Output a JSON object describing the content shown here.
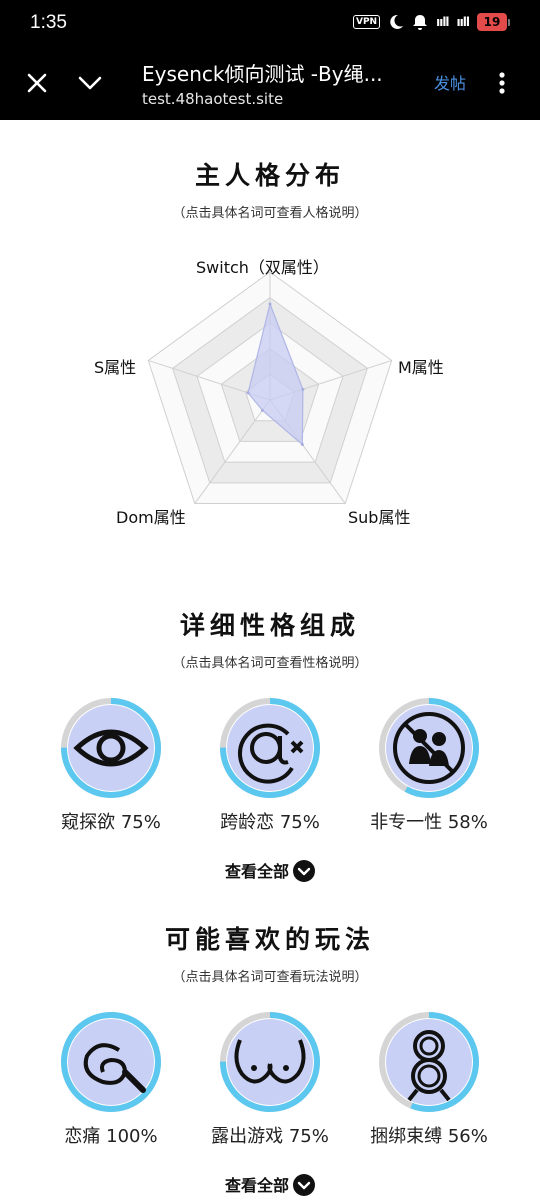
{
  "status_bar": {
    "time": "1:35",
    "vpn": "VPN",
    "signal1": "ııll",
    "signal2": "ııll",
    "battery": "19"
  },
  "top_bar": {
    "title": "Eysenck倾向测试 -By绳...",
    "url": "test.48haotest.site",
    "post_label": "发帖"
  },
  "main_personality": {
    "title": "主人格分布",
    "subtitle": "（点击具体名词可查看人格说明）",
    "axes": [
      "Switch（双属性）",
      "M属性",
      "Sub属性",
      "Dom属性",
      "S属性"
    ],
    "chart_data": {
      "type": "radar",
      "categories": [
        "Switch（双属性）",
        "M属性",
        "Sub属性",
        "Dom属性",
        "S属性"
      ],
      "values": [
        0.75,
        0.27,
        0.43,
        0.1,
        0.18
      ],
      "range": [
        0,
        1
      ],
      "fill_color": "#c7ccf1"
    }
  },
  "traits": {
    "title": "详细性格组成",
    "subtitle": "（点击具体名词可查看性格说明）",
    "items": [
      {
        "name": "窥探欲",
        "percent": "75%",
        "value": 0.75,
        "icon": "eye-icon"
      },
      {
        "name": "跨龄恋",
        "percent": "75%",
        "value": 0.75,
        "icon": "at-cross-icon"
      },
      {
        "name": "非专一性",
        "percent": "58%",
        "value": 0.58,
        "icon": "no-couple-icon"
      }
    ],
    "see_all": "查看全部"
  },
  "plays": {
    "title": "可能喜欢的玩法",
    "subtitle": "（点击具体名词可查看玩法说明）",
    "items": [
      {
        "name": "恋痛",
        "percent": "100%",
        "value": 1.0,
        "icon": "whip-icon"
      },
      {
        "name": "露出游戏",
        "percent": "75%",
        "value": 0.75,
        "icon": "breasts-icon"
      },
      {
        "name": "捆绑束缚",
        "percent": "56%",
        "value": 0.56,
        "icon": "rope-icon"
      }
    ],
    "see_all": "查看全部"
  },
  "colors": {
    "ring": "#5cc8ef",
    "ring_track": "#d5d5d5",
    "inner": "#c9d0f5"
  }
}
